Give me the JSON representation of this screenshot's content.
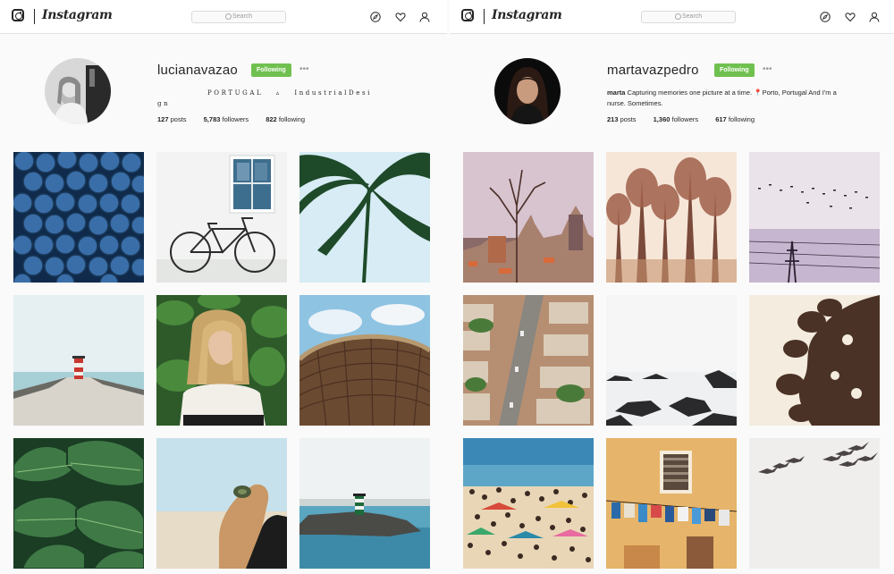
{
  "app": {
    "logo_text": "Instagram",
    "search_placeholder": "Search"
  },
  "profiles": [
    {
      "username": "lucianavazao",
      "follow_label": "Following",
      "more_label": "•••",
      "bio_line1": "PORTUGAL   ▵   IndustrialDesi",
      "bio_line2": "gn",
      "stats": {
        "posts_count": "127",
        "posts_label": "posts",
        "followers_count": "5,783",
        "followers_label": "followers",
        "following_count": "822",
        "following_label": "following"
      },
      "photos": [
        "blueberries",
        "bicycle-and-window",
        "palm-leaves",
        "pier-lighthouse",
        "girl-in-plants",
        "straw-umbrella",
        "monstera-leaves",
        "hand-with-ring",
        "sea-lighthouse"
      ]
    },
    {
      "username": "martavazpedro",
      "follow_label": "Following",
      "more_label": "•••",
      "bio_name": "marta",
      "bio_line1": "Capturing memories one picture at a time. 📍Porto, Portugal And I'm a",
      "bio_line2": "nurse. Sometimes.",
      "stats": {
        "posts_count": "213",
        "posts_label": "posts",
        "followers_count": "1,360",
        "followers_label": "followers",
        "following_count": "617",
        "following_label": "following"
      },
      "photos": [
        "porto-rooftops",
        "pastel-trees",
        "birds-power-lines",
        "city-aerial",
        "misty-rocks",
        "tree-silhouette",
        "crowded-beach",
        "laundry-facade",
        "birds-flying"
      ]
    }
  ],
  "colors": {
    "following_button": "#70c050",
    "border": "#e2e2e2"
  }
}
